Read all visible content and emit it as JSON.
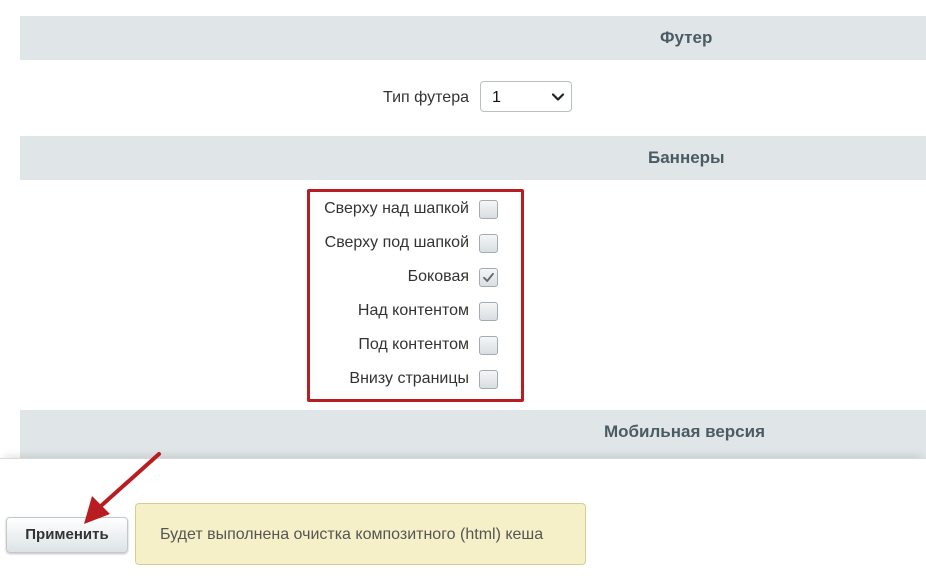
{
  "sections": {
    "footer": {
      "title": "Футер"
    },
    "banners": {
      "title": "Баннеры"
    },
    "mobile": {
      "title": "Мобильная версия"
    }
  },
  "footer_type": {
    "label": "Тип футера",
    "value": "1"
  },
  "banners": {
    "items": [
      {
        "label": "Сверху над шапкой",
        "checked": false
      },
      {
        "label": "Сверху под шапкой",
        "checked": false
      },
      {
        "label": "Боковая",
        "checked": true
      },
      {
        "label": "Над контентом",
        "checked": false
      },
      {
        "label": "Под контентом",
        "checked": false
      },
      {
        "label": "Внизу страницы",
        "checked": false
      }
    ]
  },
  "actions": {
    "apply_label": "Применить",
    "notice_text": "Будет выполнена очистка композитного (html) кеша"
  },
  "colors": {
    "highlight_box": "#b81d21",
    "annotation_arrow": "#b81d21",
    "section_header_bg": "#e0e6e8",
    "notice_bg": "#f6f0c8"
  },
  "icons": {
    "select_chevron": "chevron-down-icon",
    "checkbox_mark": "checkmark-icon",
    "annotation": "arrow-icon"
  }
}
